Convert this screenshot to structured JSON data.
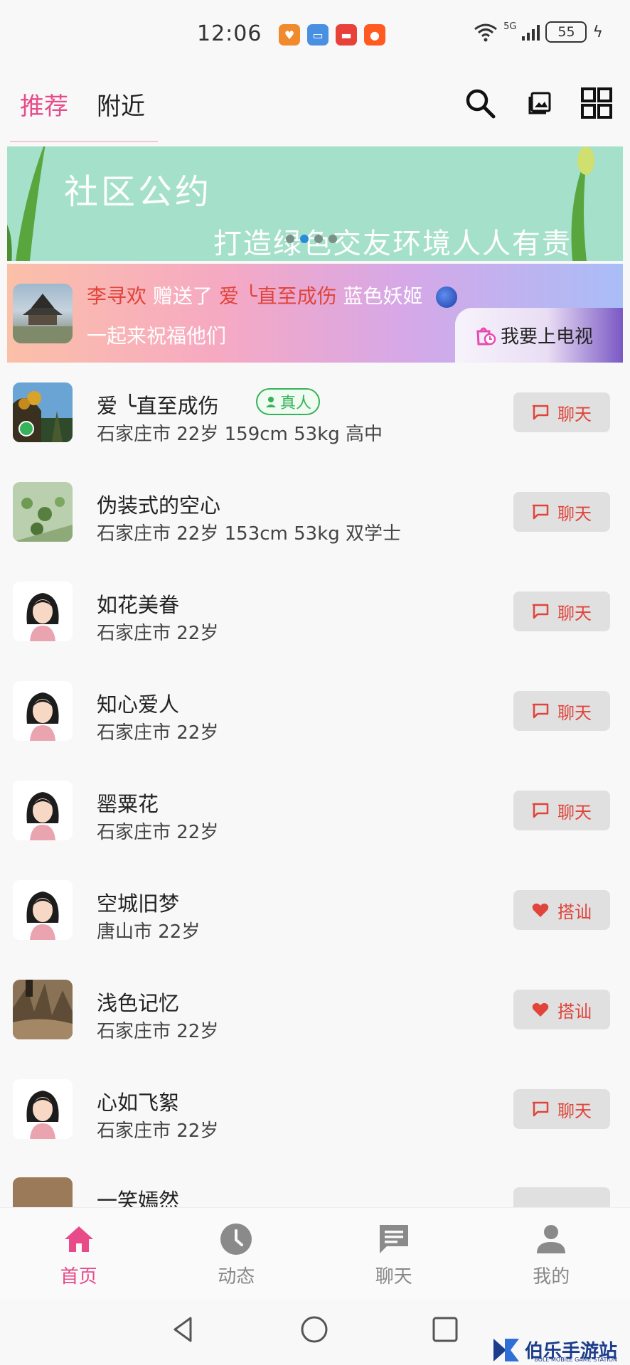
{
  "status_bar": {
    "time": "12:06",
    "network": "5G",
    "battery": "55",
    "apps": [
      {
        "icon": "heart-app-icon",
        "color": "#f08a2c"
      },
      {
        "icon": "bag-app-icon",
        "color": "#4a90e2"
      },
      {
        "icon": "huawei-app-icon",
        "color": "#e8413a"
      },
      {
        "icon": "kuaishou-app-icon",
        "color": "#ff5a1f"
      }
    ]
  },
  "top_nav": {
    "tabs": [
      "推荐",
      "附近"
    ],
    "active_tab": 0
  },
  "banner": {
    "title": "社区公约",
    "subtitle": "打造绿色交友环境人人有责",
    "background": "#a5e0cb"
  },
  "gift_message": {
    "sender": "李寻欢",
    "verb": "赠送了",
    "receiver": "爱 ╰直至成伤",
    "gift": "蓝色妖姬",
    "line2": "一起来祝福他们",
    "tv_button": "我要上电视"
  },
  "users": [
    {
      "name": "爱 ╰直至成伤",
      "info": "石家庄市 22岁 159cm 53kg 高中",
      "verified": "真人",
      "action": "聊天",
      "action_type": "chat",
      "avatar": "photo-cliff"
    },
    {
      "name": "伪装式的空心",
      "info": "石家庄市 22岁 153cm 53kg 双学士",
      "action": "聊天",
      "action_type": "chat",
      "avatar": "photo-plant"
    },
    {
      "name": "如花美眷",
      "info": "石家庄市 22岁",
      "action": "聊天",
      "action_type": "chat",
      "avatar": "girl"
    },
    {
      "name": "知心爱人",
      "info": "石家庄市 22岁",
      "action": "聊天",
      "action_type": "chat",
      "avatar": "girl"
    },
    {
      "name": "罂粟花",
      "info": "石家庄市 22岁",
      "action": "聊天",
      "action_type": "chat",
      "avatar": "girl"
    },
    {
      "name": "空城旧梦",
      "info": "唐山市 22岁",
      "action": "搭讪",
      "action_type": "greet",
      "avatar": "girl"
    },
    {
      "name": "浅色记忆",
      "info": "石家庄市 22岁",
      "action": "搭讪",
      "action_type": "greet",
      "avatar": "photo-ground"
    },
    {
      "name": "心如飞絮",
      "info": "石家庄市 22岁",
      "action": "聊天",
      "action_type": "chat",
      "avatar": "girl"
    }
  ],
  "partial_user": {
    "name": "一笑嫣然"
  },
  "bottom_nav": {
    "items": [
      "首页",
      "动态",
      "聊天",
      "我的"
    ],
    "active": 0
  },
  "colors": {
    "accent": "#e84a8a",
    "action_red": "#e0443a",
    "verified_green": "#36b25a"
  },
  "watermark": {
    "text": "伯乐手游站",
    "sub": "BOLE MOBILE GAME STATION"
  }
}
